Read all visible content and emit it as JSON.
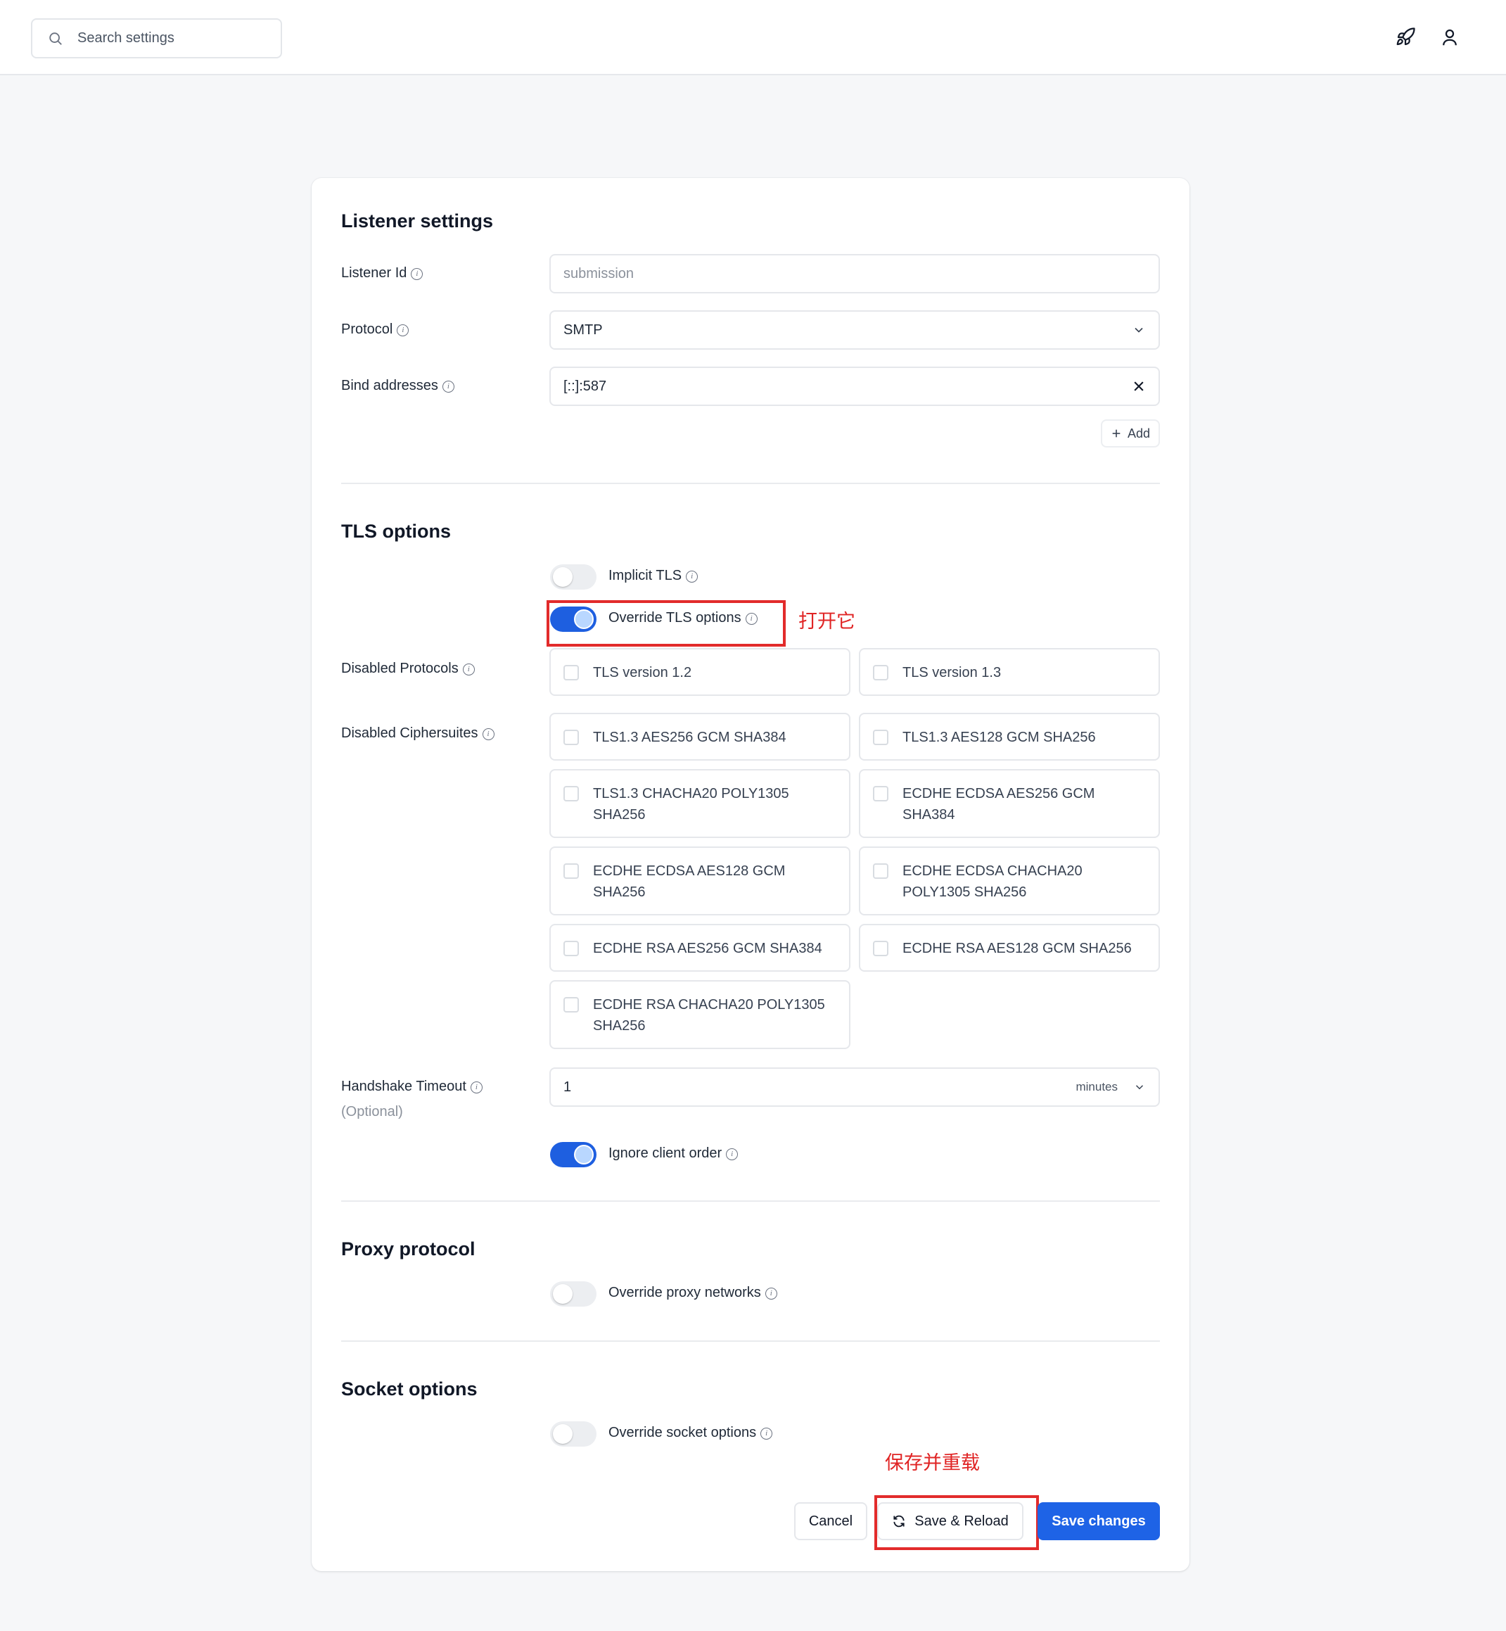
{
  "header": {
    "search_placeholder": "Search settings",
    "icons": [
      "search-icon",
      "rocket-icon",
      "user-icon"
    ]
  },
  "listener": {
    "title": "Listener settings",
    "listener_id_label": "Listener Id",
    "listener_id_value": "submission",
    "protocol_label": "Protocol",
    "protocol_value": "SMTP",
    "bind_label": "Bind addresses",
    "bind_value": "[::]:587",
    "add_label": "Add"
  },
  "tls": {
    "title": "TLS options",
    "implicit_label": "Implicit TLS",
    "implicit_on": false,
    "override_label": "Override TLS options",
    "override_on": true,
    "override_note": "打开它",
    "disabled_protocols_label": "Disabled Protocols",
    "protocols": [
      "TLS version 1.2",
      "TLS version 1.3"
    ],
    "disabled_ciphers_label": "Disabled Ciphersuites",
    "ciphers": [
      "TLS1.3 AES256 GCM SHA384",
      "TLS1.3 AES128 GCM SHA256",
      "TLS1.3 CHACHA20 POLY1305 SHA256",
      "ECDHE ECDSA AES256 GCM SHA384",
      "ECDHE ECDSA AES128 GCM SHA256",
      "ECDHE ECDSA CHACHA20 POLY1305 SHA256",
      "ECDHE RSA AES256 GCM SHA384",
      "ECDHE RSA AES128 GCM SHA256",
      "ECDHE RSA CHACHA20 POLY1305 SHA256"
    ],
    "handshake_label": "Handshake Timeout",
    "handshake_optional": "(Optional)",
    "handshake_value": "1",
    "handshake_unit": "minutes",
    "ignore_order_label": "Ignore client order",
    "ignore_order_on": true
  },
  "proxy": {
    "title": "Proxy protocol",
    "override_label": "Override proxy networks",
    "override_on": false
  },
  "socket": {
    "title": "Socket options",
    "override_label": "Override socket options",
    "override_on": false
  },
  "actions": {
    "cancel": "Cancel",
    "save_reload": "Save & Reload",
    "save_reload_note": "保存并重载",
    "save_changes": "Save changes"
  },
  "colors": {
    "primary": "#1e63e6",
    "annotation": "#e22b2b"
  }
}
